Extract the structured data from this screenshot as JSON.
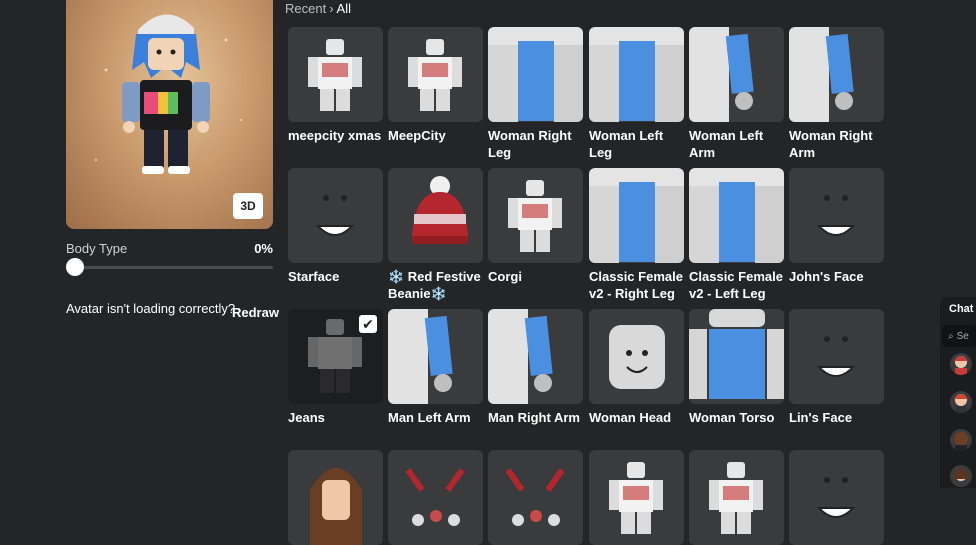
{
  "preview": {
    "btn_3d": "3D"
  },
  "body_type": {
    "label": "Body Type",
    "value": "0%",
    "fraction": 0
  },
  "loading": {
    "text": "Avatar isn't loading correctly?",
    "redraw": "Redraw"
  },
  "breadcrumb": {
    "recent": "Recent",
    "sep": "›",
    "current": "All"
  },
  "items": [
    {
      "name": "meepcity xmas",
      "icon": "shirt-figure-icon"
    },
    {
      "name": "MeepCity",
      "icon": "shirt-figure-icon"
    },
    {
      "name": "Woman Right Leg",
      "icon": "leg-icon"
    },
    {
      "name": "Woman Left Leg",
      "icon": "leg-icon"
    },
    {
      "name": "Woman Left Arm",
      "icon": "arm-icon"
    },
    {
      "name": "Woman Right Arm",
      "icon": "arm-icon"
    },
    {
      "name": "Starface",
      "icon": "face-icon"
    },
    {
      "name": "❄️ Red Festive Beanie❄️",
      "icon": "beanie-icon"
    },
    {
      "name": "Corgi",
      "icon": "shirt-figure-icon"
    },
    {
      "name": "Classic Female v2 - Right Leg",
      "icon": "leg-icon"
    },
    {
      "name": "Classic Female v2 - Left Leg",
      "icon": "leg-icon"
    },
    {
      "name": "John's Face",
      "icon": "face-icon"
    },
    {
      "name": "Jeans",
      "icon": "pants-figure-icon",
      "selected": true
    },
    {
      "name": "Man Left Arm",
      "icon": "arm-icon"
    },
    {
      "name": "Man Right Arm",
      "icon": "arm-icon"
    },
    {
      "name": "Woman Head",
      "icon": "head-icon"
    },
    {
      "name": "Woman Torso",
      "icon": "torso-icon"
    },
    {
      "name": "Lin's Face",
      "icon": "face-icon"
    },
    {
      "name": "",
      "icon": "hair-icon"
    },
    {
      "name": "",
      "icon": "accessory-icon"
    },
    {
      "name": "",
      "icon": "accessory-icon"
    },
    {
      "name": "",
      "icon": "shirt-figure-icon"
    },
    {
      "name": "",
      "icon": "shirt-figure-icon"
    },
    {
      "name": "",
      "icon": "face-icon"
    }
  ],
  "chat": {
    "label": "Chat",
    "search_placeholder": "Se"
  },
  "colors": {
    "background": "#232527",
    "tile": "#393b3d",
    "blue_pattern": "#4a8fe0"
  }
}
